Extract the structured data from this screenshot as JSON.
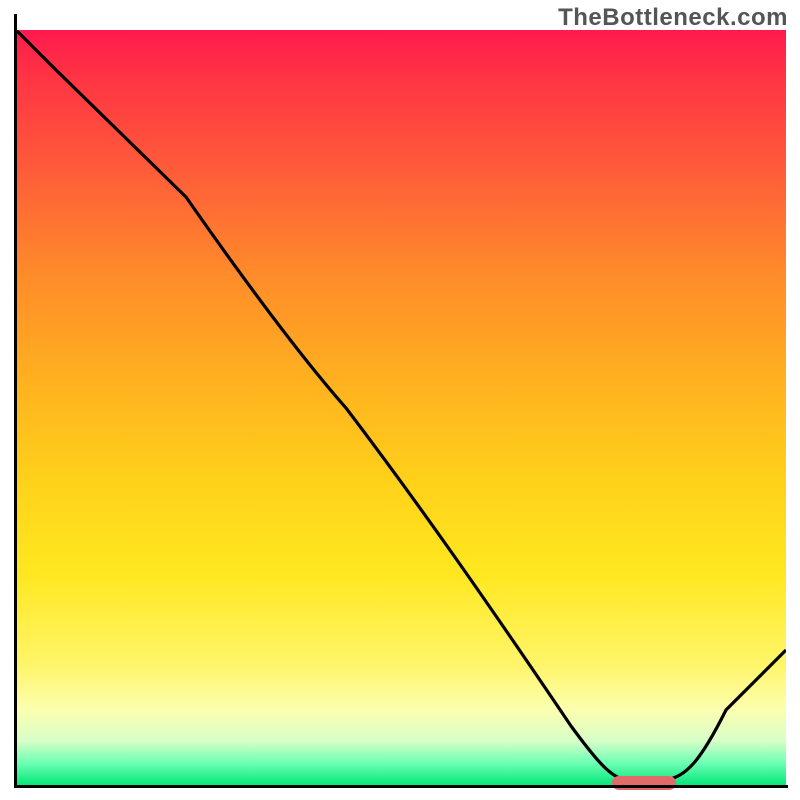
{
  "watermark_text": "TheBottleneck.com",
  "colors": {
    "gradient_top": "#ff1a4d",
    "gradient_mid": "#ffde1a",
    "gradient_bottom": "#00e676",
    "axis": "#000000",
    "curve": "#000000",
    "marker": "#e26a6a",
    "watermark": "#555555"
  },
  "chart_data": {
    "type": "line",
    "title": "",
    "xlabel": "",
    "ylabel": "",
    "xlim": [
      0,
      100
    ],
    "ylim": [
      0,
      100
    ],
    "grid": false,
    "legend": false,
    "x": [
      0,
      5,
      22,
      43,
      60,
      72,
      78,
      84,
      90,
      100
    ],
    "values": [
      100,
      95,
      78,
      50,
      27,
      8,
      1,
      0.5,
      2,
      18
    ],
    "marker": {
      "x_start": 78,
      "x_end": 86,
      "y": 0.5
    },
    "note": "x and y normalized 0-100 to plot extents; no axis tick labels are visible in the image"
  }
}
